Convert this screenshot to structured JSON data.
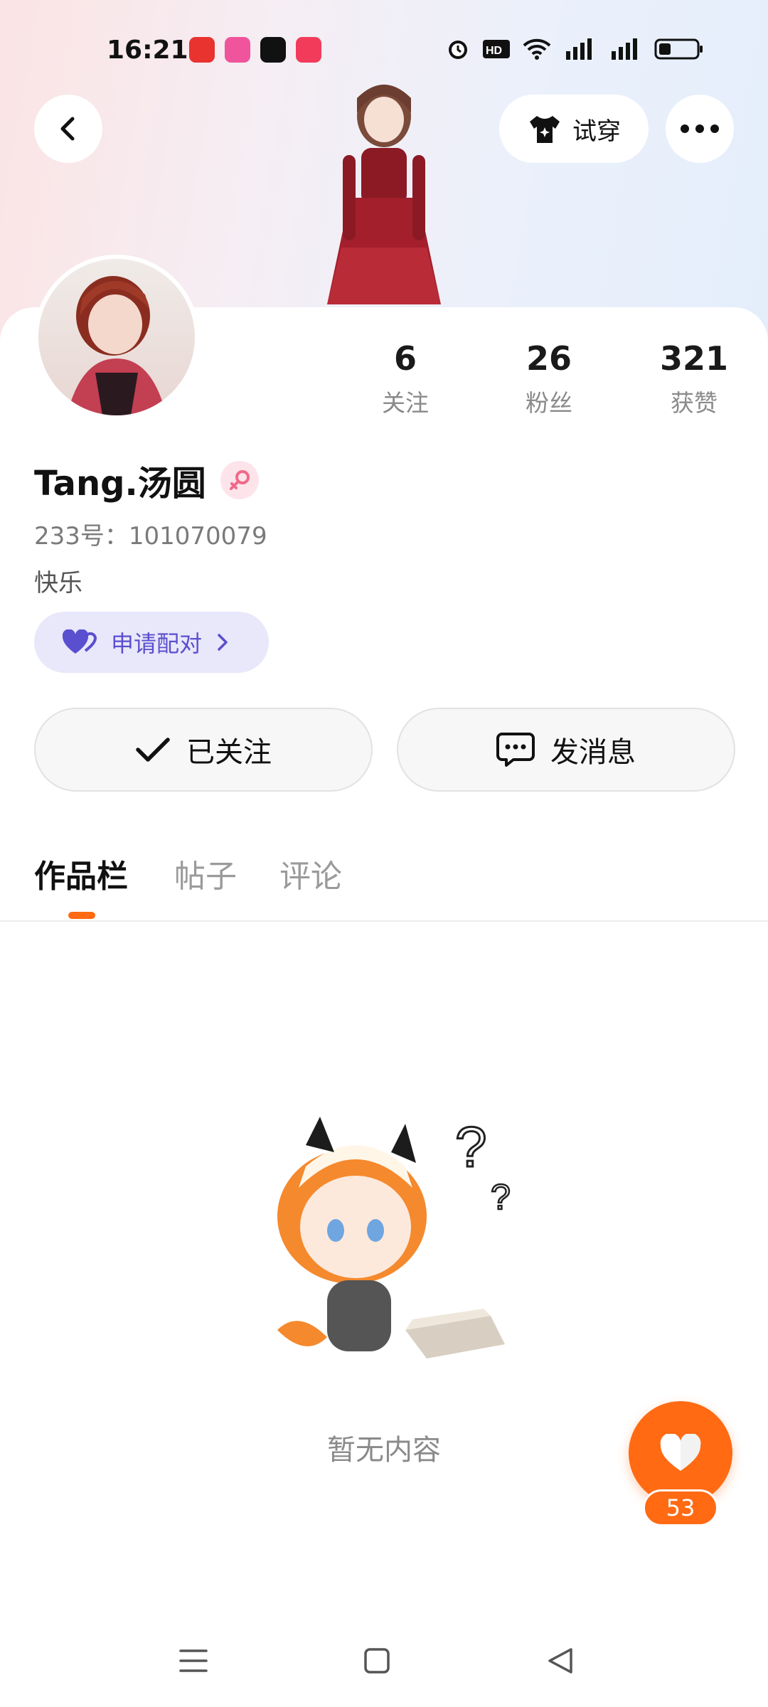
{
  "status_bar": {
    "time": "16:21"
  },
  "header": {
    "tryon_label": "试穿"
  },
  "profile": {
    "username": "Tang.汤圆",
    "user_id": "233号：101070079",
    "bio": "快乐",
    "pair_label": "申请配对"
  },
  "stats": [
    {
      "value": "6",
      "label": "关注"
    },
    {
      "value": "26",
      "label": "粉丝"
    },
    {
      "value": "321",
      "label": "获赞"
    }
  ],
  "actions": {
    "followed_label": "已关注",
    "message_label": "发消息"
  },
  "tabs": [
    {
      "label": "作品栏"
    },
    {
      "label": "帖子"
    },
    {
      "label": "评论"
    }
  ],
  "empty_state": {
    "text": "暂无内容"
  },
  "like": {
    "count": "53"
  },
  "colors": {
    "accent": "#ff6a13",
    "pair_text": "#5a4fcf",
    "pair_bg": "#e9e7fa"
  }
}
